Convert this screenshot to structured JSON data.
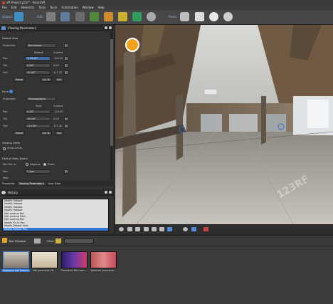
{
  "window": {
    "title": "VR Project.p2vr* - Pano2VR"
  },
  "menu": [
    "File",
    "Edit",
    "Elements",
    "Tools",
    "Tours",
    "Automation",
    "Window",
    "Help"
  ],
  "toolbar": {
    "output_label": "Output:",
    "edit_label": "Edit:",
    "views_label": "Views:"
  },
  "viewing_parameters": {
    "title": "Viewing Parameters",
    "default_view": {
      "section": "Default View",
      "projection_label": "Projection:",
      "projection_value": "Rectilinear",
      "col_default": "Default",
      "col_current": "Current",
      "pan_label": "Pan:",
      "pan_default": "-129.20°",
      "pan_current": "-129.20",
      "tilt_label": "Tilt:",
      "tilt_default": "0.00°",
      "tilt_current": "0.00",
      "fov_label": "FoV:",
      "fov_default": "70.00°",
      "fov_current": "111.32",
      "reset": "Reset",
      "goto": "Go To",
      "set": "Set"
    },
    "fly_in": {
      "section": "Fly In",
      "projection_label": "Projection:",
      "projection_value": "Stereographic",
      "col_start": "Start",
      "col_current": "Current",
      "pan_label": "Pan:",
      "pan_start": "0.00°",
      "pan_current": "-129.20",
      "tilt_label": "Tilt:",
      "tilt_start": "-90.00°",
      "tilt_current": "0.00",
      "fov_label": "FoV:",
      "fov_start": "170.00°",
      "fov_current": "111.32",
      "reset": "Reset",
      "goto": "Go To",
      "set": "Set"
    },
    "viewing_limits": {
      "section": "Viewing Limits",
      "show_limits": "Show Limits"
    },
    "fov_zoom": {
      "section": "Field of View (Zoom)",
      "min_fov_label": "Min FoV in:",
      "degrees": "Degrees",
      "pixels": "Pixels",
      "min_label": "Min:",
      "min_value": "1.0px",
      "max_label": "Max:"
    }
  },
  "tabs": [
    "Properties",
    "Viewing Parameters",
    "User Data"
  ],
  "history": {
    "title": "History",
    "items": [
      "Modify Hotspot",
      "Modify Hotspot",
      "Modify Hotspot",
      "Modify Hotspot",
      "Edit Looking Roll",
      "Edit Looking Pitch",
      "Edit Looking Roll",
      "Modify Fly In Pan",
      "Modify Default View",
      "Modify Default Pan"
    ],
    "selected_index": 9
  },
  "tour_browser": {
    "title": "Tour Browser",
    "filter_label": "Filter:",
    "thumbs": [
      "Kalgoorlie Hall Feature",
      "360 panorama VR...",
      "Panorama 360 room...",
      "Spherical panorama..."
    ]
  },
  "watermark": "123RF"
}
